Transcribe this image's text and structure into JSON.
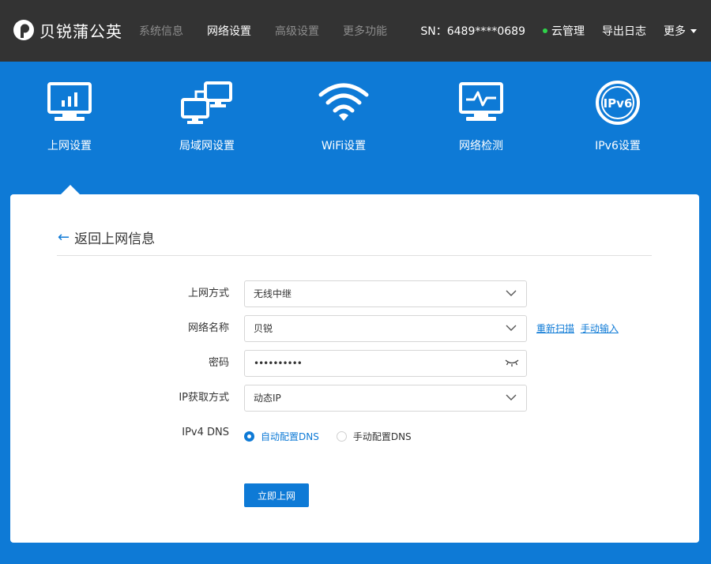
{
  "brand": {
    "name": "贝锐蒲公英"
  },
  "nav": {
    "items": [
      {
        "label": "系统信息",
        "active": false
      },
      {
        "label": "网络设置",
        "active": true
      },
      {
        "label": "高级设置",
        "active": false
      },
      {
        "label": "更多功能",
        "active": false
      }
    ]
  },
  "header_right": {
    "sn": "SN：6489****0689",
    "cloud": "云管理",
    "export": "导出日志",
    "more": "更多"
  },
  "tiles": [
    {
      "label": "上网设置",
      "icon": "monitor-chart-icon",
      "active": true
    },
    {
      "label": "局域网设置",
      "icon": "lan-computers-icon",
      "active": false
    },
    {
      "label": "WiFi设置",
      "icon": "wifi-icon",
      "active": false
    },
    {
      "label": "网络检测",
      "icon": "monitor-pulse-icon",
      "active": false
    },
    {
      "label": "IPv6设置",
      "icon": "ipv6-icon",
      "active": false
    }
  ],
  "ipv6_icon_text": "IPv6",
  "back": {
    "label": "返回上网信息"
  },
  "form": {
    "mode": {
      "label": "上网方式",
      "value": "无线中继"
    },
    "ssid": {
      "label": "网络名称",
      "value": "贝锐"
    },
    "links": {
      "rescan": "重新扫描",
      "manual": "手动输入"
    },
    "password": {
      "label": "密码",
      "value": "••••••••••"
    },
    "ip_mode": {
      "label": "IP获取方式",
      "value": "动态IP"
    },
    "dns": {
      "label": "IPv4 DNS",
      "auto": "自动配置DNS",
      "manual": "手动配置DNS",
      "selected": "auto"
    },
    "submit": "立即上网"
  },
  "colors": {
    "topbar": "#333333",
    "accent": "#0e7ad6",
    "online_dot": "#2fd34a"
  }
}
